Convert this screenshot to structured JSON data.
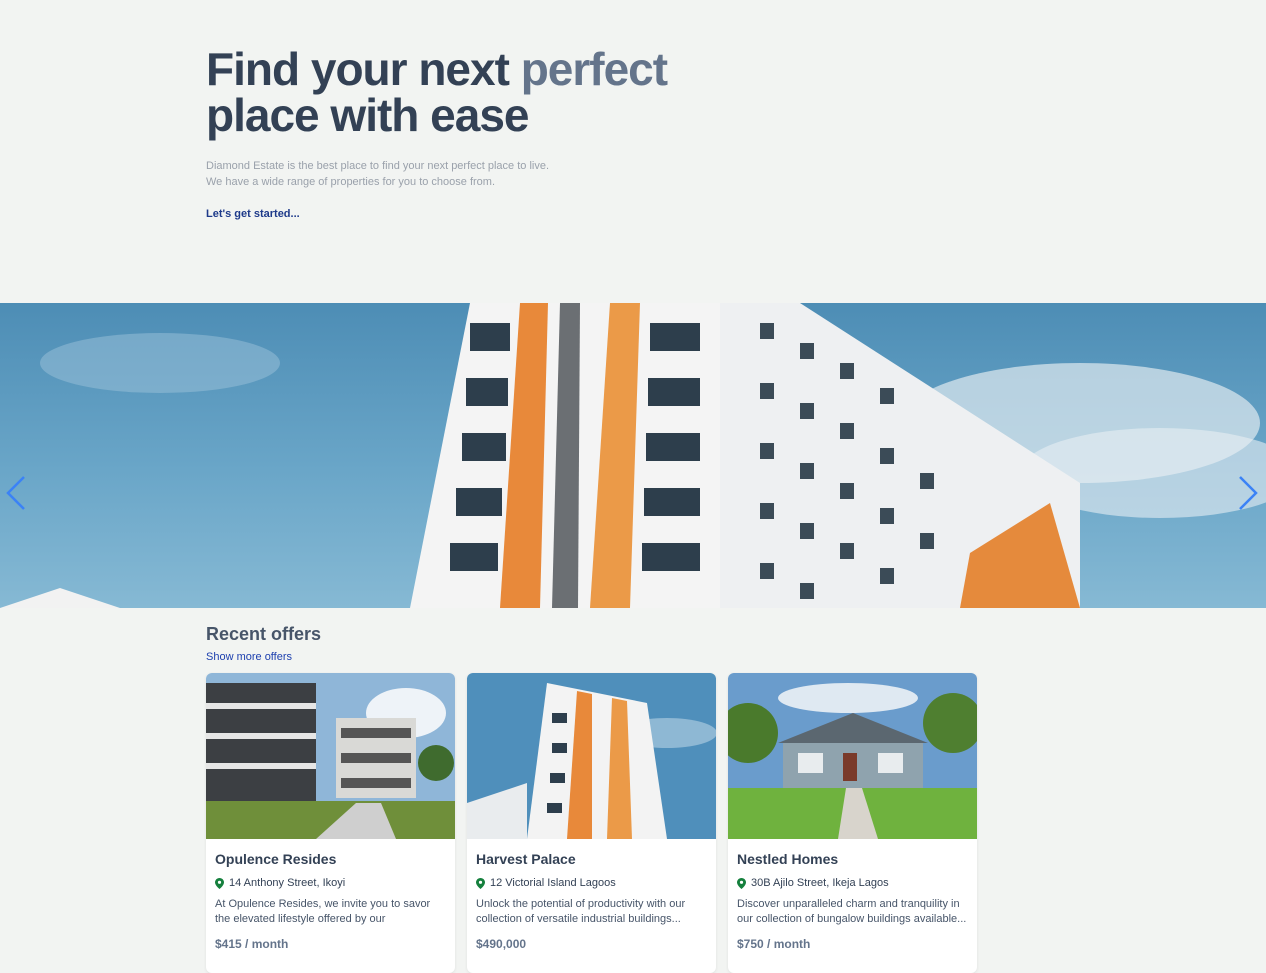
{
  "hero": {
    "title_part1": "Find your next ",
    "title_accent": "perfect",
    "title_part2": "place with ease",
    "desc_line1": "Diamond Estate is the best place to find your next perfect place to live.",
    "desc_line2": "We have a wide range of properties for you to choose from.",
    "cta": "Let's get started..."
  },
  "slider": {
    "prev_icon": "chevron-left-icon",
    "next_icon": "chevron-right-icon",
    "accent_color": "#3b82f6"
  },
  "offers": {
    "heading": "Recent offers",
    "more_link": "Show more offers",
    "items": [
      {
        "title": "Opulence Resides",
        "address": "14 Anthony Street, Ikoyi",
        "description": "At Opulence Resides, we invite you to savor the elevated lifestyle offered by our meticulously...",
        "price": "$415 / month"
      },
      {
        "title": "Harvest Palace",
        "address": "12 Victorial Island Lagoos",
        "description": "Unlock the potential of productivity with our collection of versatile industrial buildings...",
        "price": "$490,000"
      },
      {
        "title": "Nestled Homes",
        "address": "30B Ajilo Street, Ikeja Lagos",
        "description": "Discover unparalleled charm and tranquility in our collection of bungalow buildings available...",
        "price": "$750 / month"
      }
    ]
  },
  "colors": {
    "background": "#f2f4f2",
    "heading": "#334155",
    "heading_accent": "#64748b",
    "link": "#1e40af",
    "pin": "#15803d"
  }
}
